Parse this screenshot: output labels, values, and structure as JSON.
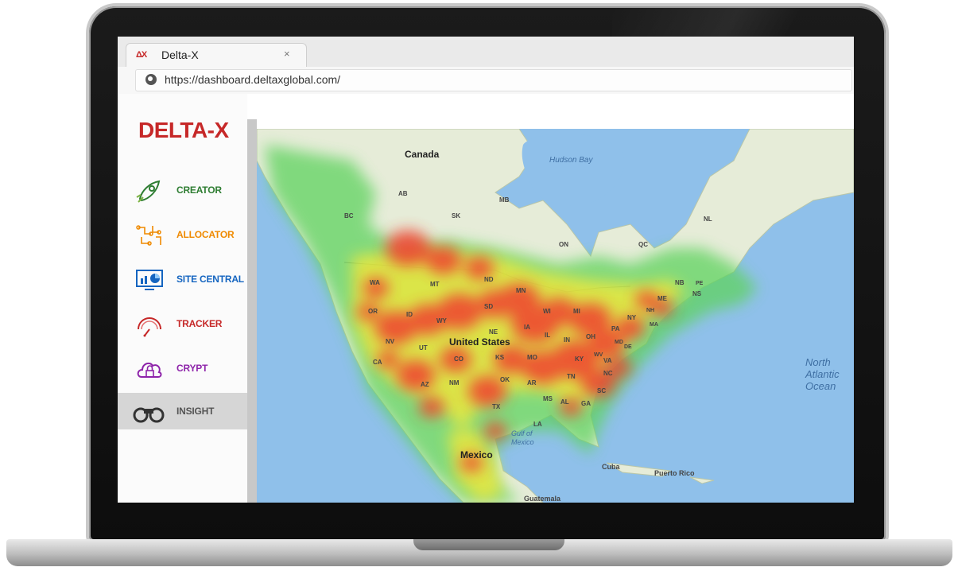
{
  "browser": {
    "tab": {
      "favicon": "ΔX",
      "title": "Delta-X",
      "close": "×"
    },
    "url": "https://dashboard.deltaxglobal.com/",
    "globe_icon": "globe-icon"
  },
  "app": {
    "logo": "DELTA-X",
    "nav": [
      {
        "label": "CREATOR",
        "icon": "rocket-icon",
        "color": "#2e7d32"
      },
      {
        "label": "ALLOCATOR",
        "icon": "circuit-icon",
        "color": "#ef8a00"
      },
      {
        "label": "SITE CENTRAL",
        "icon": "monitor-chart-icon",
        "color": "#1565c0"
      },
      {
        "label": "TRACKER",
        "icon": "gauge-icon",
        "color": "#c62828"
      },
      {
        "label": "CRYPT",
        "icon": "cloud-lock-icon",
        "color": "#8e24aa"
      },
      {
        "label": "INSIGHT",
        "icon": "binoculars-icon",
        "color": "#555555",
        "active": true
      }
    ]
  },
  "map": {
    "labels": {
      "canada": "Canada",
      "hudson_bay": "Hudson Bay",
      "ab": "AB",
      "bc": "BC",
      "sk": "SK",
      "mb": "MB",
      "on": "ON",
      "qc": "QC",
      "nl": "NL",
      "nb": "NB",
      "pe": "PE",
      "ns": "NS",
      "wa": "WA",
      "mt": "MT",
      "nd": "ND",
      "mn": "MN",
      "or": "OR",
      "id": "ID",
      "wy": "WY",
      "sd": "SD",
      "wi": "WI",
      "mi": "MI",
      "ny": "NY",
      "nh": "NH",
      "me": "ME",
      "ma": "MA",
      "nv": "NV",
      "ut": "UT",
      "ne": "NE",
      "ia": "IA",
      "il": "IL",
      "in": "IN",
      "oh": "OH",
      "pa": "PA",
      "md": "MD",
      "de": "DE",
      "ca": "CA",
      "co": "CO",
      "ks": "KS",
      "mo": "MO",
      "ky": "KY",
      "wv": "WV",
      "va": "VA",
      "az": "AZ",
      "nm": "NM",
      "ok": "OK",
      "ar": "AR",
      "tn": "TN",
      "nc": "NC",
      "tx": "TX",
      "ms": "MS",
      "al": "AL",
      "ga": "GA",
      "sc": "SC",
      "la": "LA",
      "united_states": "United States",
      "north_atlantic": [
        "North",
        "Atlantic",
        "Ocean"
      ],
      "gulf": [
        "Gulf of",
        "Mexico"
      ],
      "mexico": "Mexico",
      "cuba": "Cuba",
      "puerto_rico": "Puerto Rico",
      "guatemala": "Guatemala"
    },
    "colors": {
      "water": "#8fc0ea",
      "land": "#e6ecd8",
      "heat_low": "#5ed35e",
      "heat_mid": "#f2e83a",
      "heat_high": "#ef3f2f"
    }
  }
}
